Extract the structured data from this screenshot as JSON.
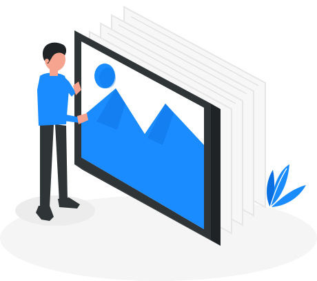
{
  "illustration": {
    "subject": "person-presenting-picture-frames",
    "icons": [
      "image-gallery-icon",
      "mountain-icon",
      "sun-icon",
      "leaf-plant-icon"
    ]
  },
  "colors": {
    "accent_blue": "#1a8cff",
    "accent_blue_dark": "#0a6fe0",
    "frame_dark": "#2f3437",
    "frame_dark_side": "#1f2325",
    "back_frame": "#eeeeee",
    "back_frame_outline": "#dedede",
    "sky_white": "#ffffff",
    "shadow_floor": "#f3f3f3",
    "skin": "#f6a48f",
    "hair": "#1f2325",
    "shirt": "#1a8cff",
    "pants": "#2f3437",
    "shoes": "#2f3437"
  }
}
